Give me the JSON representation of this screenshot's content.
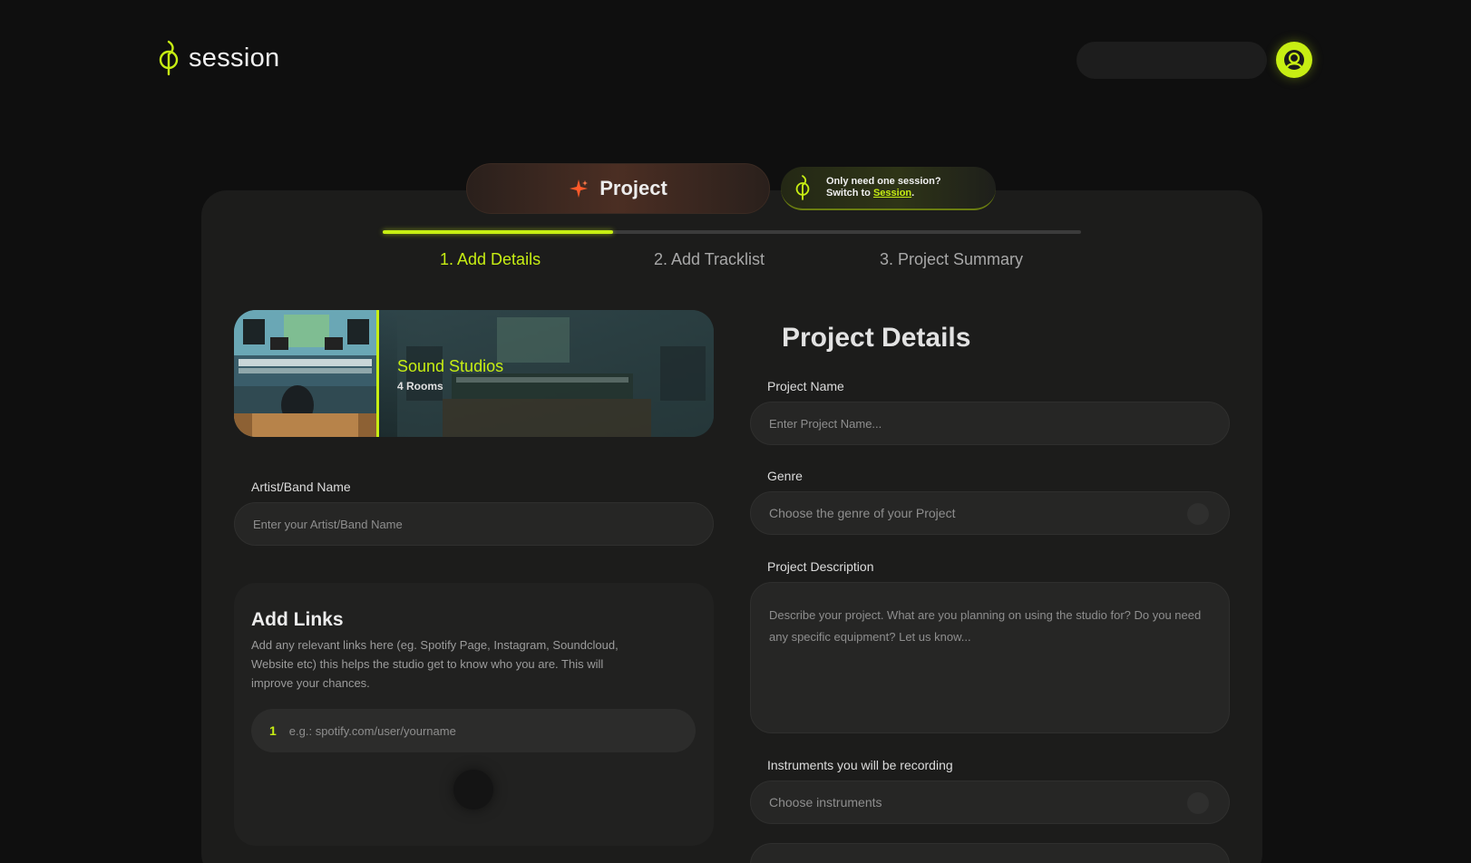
{
  "header": {
    "logo_text": "session",
    "accent": "#c7ee13"
  },
  "tabs": {
    "project_label": "Project",
    "switch_line1": "Only need one session?",
    "switch_prefix": "Switch to ",
    "switch_link": "Session",
    "switch_suffix": "."
  },
  "progress": {
    "fraction": 0.33,
    "steps": [
      "1. Add Details",
      "2. Add Tracklist",
      "3. Project Summary"
    ]
  },
  "studio": {
    "name": "Sound Studios",
    "rooms": "4 Rooms"
  },
  "artist": {
    "label": "Artist/Band Name",
    "placeholder": "Enter your Artist/Band Name"
  },
  "links": {
    "title": "Add Links",
    "description": "Add any relevant links here (eg. Spotify Page, Instagram, Soundcloud, Website etc) this helps the studio get to know who you are. This will improve your chances.",
    "index": "1",
    "placeholder": "e.g.: spotify.com/user/yourname"
  },
  "details": {
    "title": "Project Details",
    "name_label": "Project Name",
    "name_placeholder": "Enter Project Name...",
    "genre_label": "Genre",
    "genre_placeholder": "Choose the genre of your Project",
    "description_label": "Project Description",
    "description_placeholder": "Describe your project. What are you planning on using the studio for? Do you need any specific equipment? Let us know...",
    "instruments_label": "Instruments you will be recording",
    "instruments_placeholder": "Choose instruments"
  }
}
